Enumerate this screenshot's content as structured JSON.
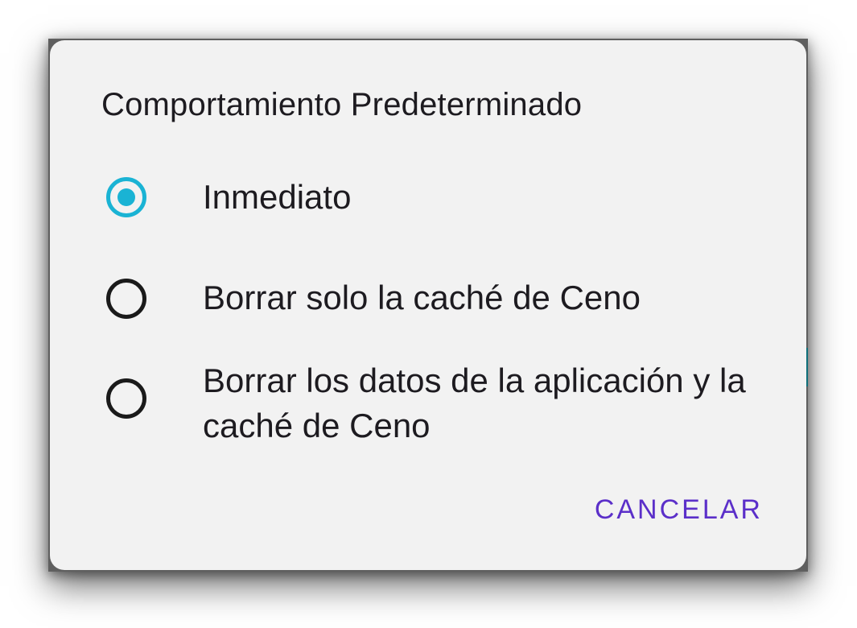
{
  "dialog": {
    "title": "Comportamiento Predeterminado",
    "options": [
      {
        "label": "Inmediato",
        "selected": true
      },
      {
        "label": "Borrar solo la caché de Ceno",
        "selected": false
      },
      {
        "label": "Borrar los datos de la aplicación y la caché de Ceno",
        "selected": false
      }
    ],
    "cancel_label": "CANCELAR"
  },
  "colors": {
    "radio_selected": "#1ab3d4",
    "accent_button": "#5b2fc9",
    "dialog_background": "#f2f2f2",
    "text_primary": "#1d1b20"
  }
}
